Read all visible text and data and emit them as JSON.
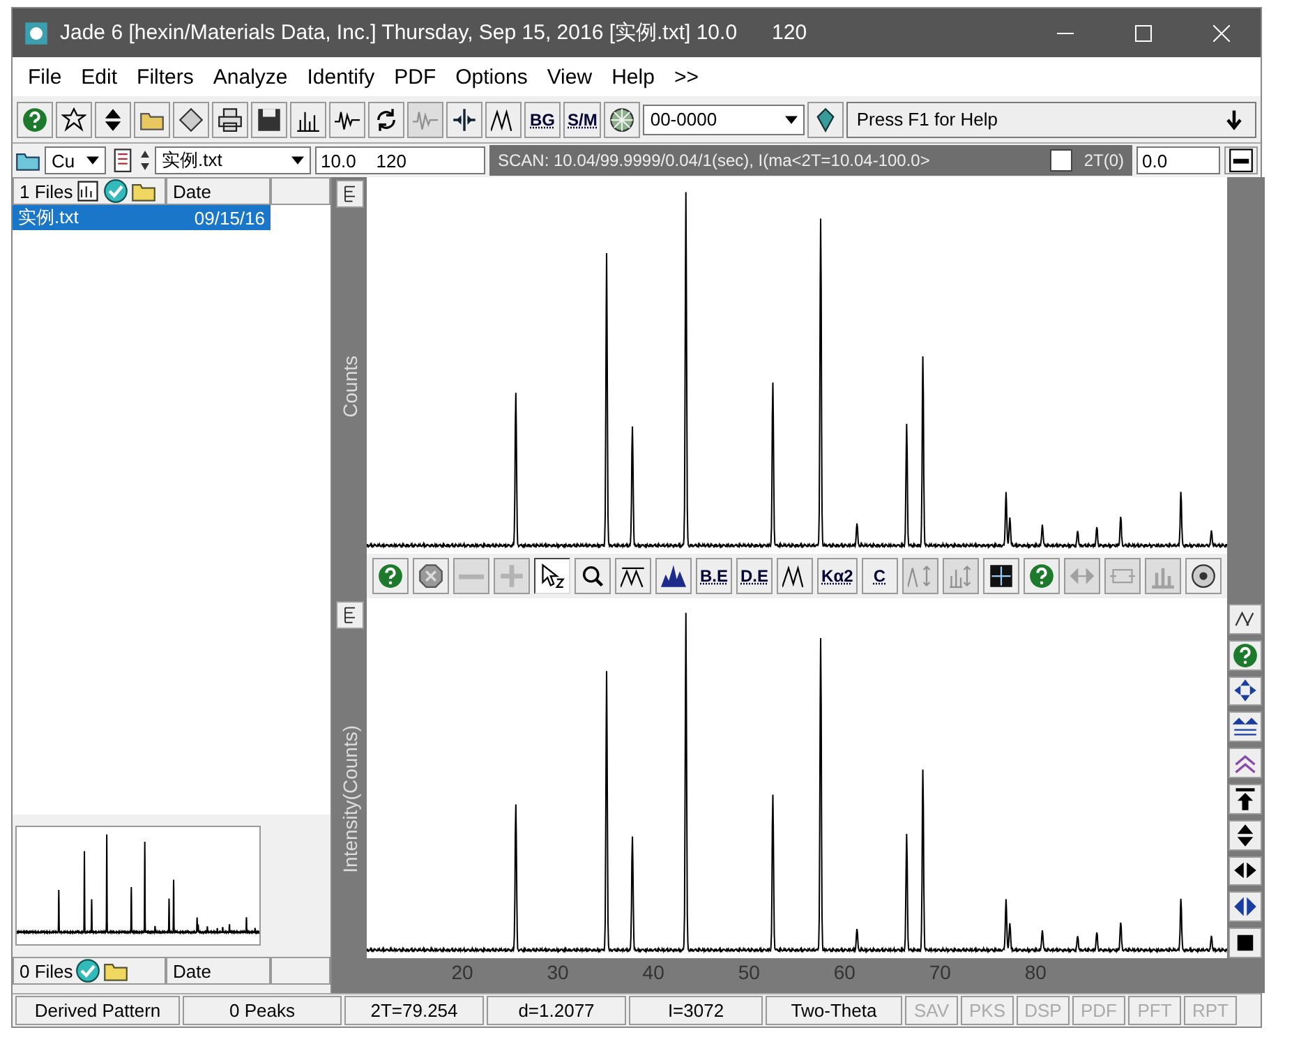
{
  "window": {
    "title": "Jade 6 [hexin/Materials Data, Inc.] Thursday, Sep 15, 2016 [实例.txt] 10.0      120"
  },
  "menu": [
    "File",
    "Edit",
    "Filters",
    "Analyze",
    "Identify",
    "PDF",
    "Options",
    "View",
    "Help",
    ">>"
  ],
  "toolbar": {
    "buttons": [
      {
        "kind": "icon",
        "disabled": false
      },
      {
        "kind": "icon",
        "disabled": false
      },
      {
        "kind": "icon",
        "disabled": false
      },
      {
        "kind": "icon",
        "disabled": false
      },
      {
        "kind": "icon",
        "disabled": false
      },
      {
        "kind": "icon",
        "disabled": false
      },
      {
        "kind": "icon",
        "disabled": false
      },
      {
        "kind": "icon",
        "disabled": false
      },
      {
        "kind": "icon",
        "disabled": false
      },
      {
        "kind": "icon",
        "disabled": false
      },
      {
        "kind": "icon",
        "disabled": true
      },
      {
        "kind": "icon",
        "disabled": false
      },
      {
        "kind": "icon",
        "disabled": false
      },
      {
        "kind": "text",
        "label": "BG",
        "disabled": false
      },
      {
        "kind": "text",
        "label": "S/M",
        "disabled": false
      },
      {
        "kind": "icon",
        "disabled": false
      }
    ],
    "pdf_field": {
      "value": "00-0000"
    },
    "help_text": "Press F1 for Help"
  },
  "scan_bar": {
    "radiation": "Cu",
    "file": "实例.txt",
    "range": "10.0    120",
    "scan_info": "SCAN: 10.04/99.9999/0.04/1(sec), I(ma<2T=10.04-100.0>",
    "offset_checked": false,
    "offset_label": "2T(0)",
    "offset_value": "0.0"
  },
  "file_list": {
    "count": "1 Files",
    "date_header": "Date",
    "files": [
      {
        "name": "实例.txt",
        "date": "09/15/16",
        "selected": true
      }
    ]
  },
  "lower_list": {
    "count": "0 Files",
    "date_header": "Date"
  },
  "top_plot": {
    "ylabel": "Counts"
  },
  "plot_toolbar": [
    {
      "kind": "icon",
      "disabled": false,
      "selected": false
    },
    {
      "kind": "icon",
      "disabled": false,
      "selected": false
    },
    {
      "kind": "icon",
      "disabled": true,
      "selected": false
    },
    {
      "kind": "icon",
      "disabled": true,
      "selected": false
    },
    {
      "kind": "icon",
      "disabled": false,
      "selected": true
    },
    {
      "kind": "icon",
      "disabled": false,
      "selected": false
    },
    {
      "kind": "icon",
      "disabled": false,
      "selected": false
    },
    {
      "kind": "icon",
      "disabled": false,
      "selected": false
    },
    {
      "kind": "text",
      "label": "B.E",
      "disabled": false,
      "selected": false
    },
    {
      "kind": "text",
      "label": "D.E",
      "disabled": false,
      "selected": false
    },
    {
      "kind": "icon",
      "disabled": false,
      "selected": false
    },
    {
      "kind": "text",
      "label": "Kα2",
      "disabled": false,
      "selected": false
    },
    {
      "kind": "text",
      "label": "C",
      "disabled": false,
      "selected": false
    },
    {
      "kind": "icon",
      "disabled": true,
      "selected": false
    },
    {
      "kind": "icon",
      "disabled": true,
      "selected": false
    },
    {
      "kind": "icon",
      "disabled": false,
      "selected": false
    },
    {
      "kind": "icon",
      "disabled": false,
      "selected": false
    },
    {
      "kind": "icon",
      "disabled": true,
      "selected": false
    },
    {
      "kind": "icon",
      "disabled": true,
      "selected": false
    },
    {
      "kind": "icon",
      "disabled": true,
      "selected": false
    },
    {
      "kind": "icon",
      "disabled": false,
      "selected": false
    }
  ],
  "bottom_plot": {
    "ylabel": "Intensity(Counts)",
    "x_tick_labels": [
      "20",
      "30",
      "40",
      "50",
      "60",
      "70",
      "80"
    ]
  },
  "status_bar": [
    {
      "text": "Derived Pattern",
      "disabled": false
    },
    {
      "text": "0 Peaks",
      "disabled": false
    },
    {
      "text": "2T=79.254",
      "disabled": false
    },
    {
      "text": "d=1.2077",
      "disabled": false
    },
    {
      "text": "I=3072",
      "disabled": false
    },
    {
      "text": "Two-Theta",
      "disabled": false
    },
    {
      "text": "SAV",
      "disabled": true
    },
    {
      "text": "PKS",
      "disabled": true
    },
    {
      "text": "DSP",
      "disabled": true
    },
    {
      "text": "PDF",
      "disabled": true
    },
    {
      "text": "PFT",
      "disabled": true
    },
    {
      "text": "RPT",
      "disabled": true
    }
  ]
}
